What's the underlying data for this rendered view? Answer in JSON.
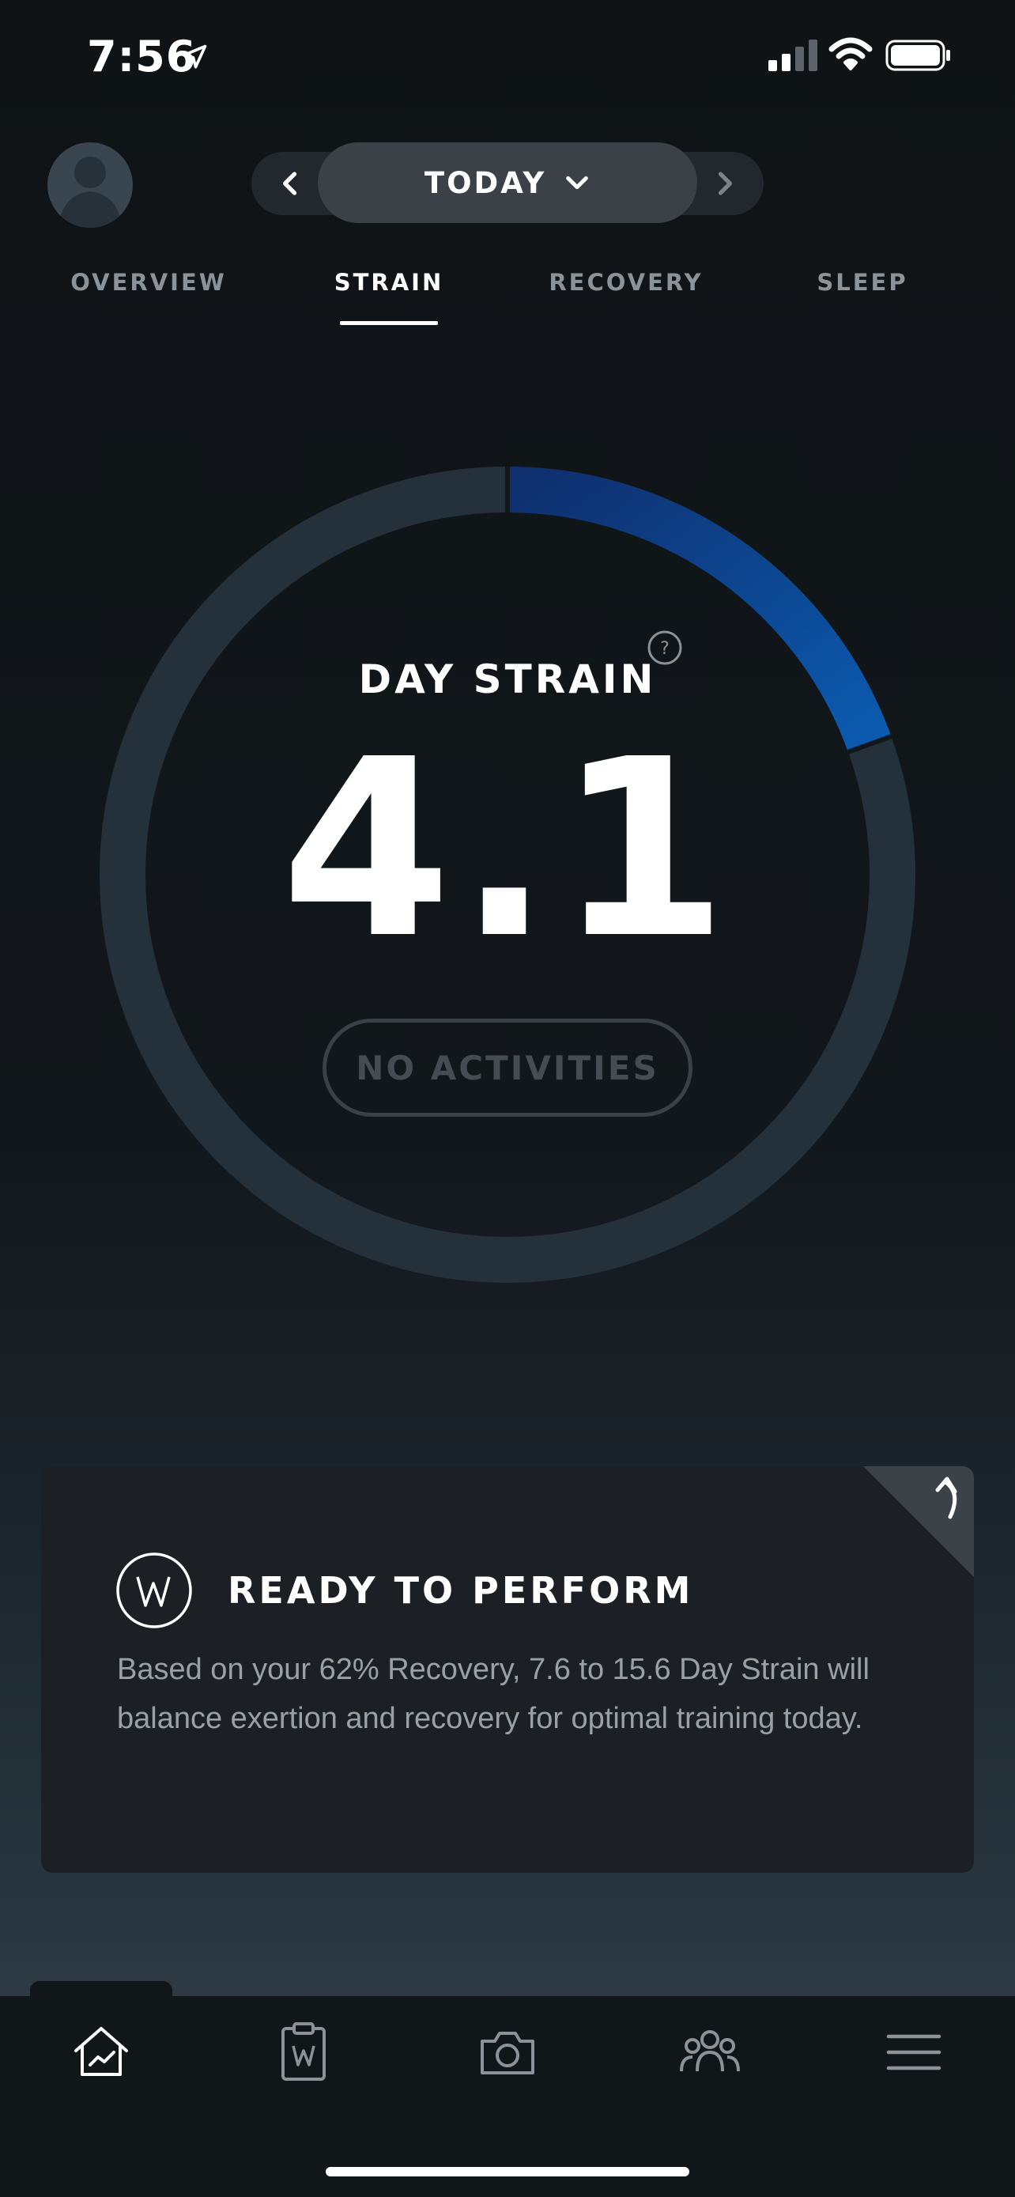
{
  "status_bar": {
    "time": "7:56"
  },
  "header": {
    "date_label": "TODAY"
  },
  "tabs": [
    {
      "label": "OVERVIEW",
      "active": false
    },
    {
      "label": "STRAIN",
      "active": true
    },
    {
      "label": "RECOVERY",
      "active": false
    },
    {
      "label": "SLEEP",
      "active": false
    }
  ],
  "strain": {
    "title": "DAY STRAIN",
    "value": "4.1",
    "activities_label": "NO ACTIVITIES",
    "help_symbol": "?",
    "max_scale": 21,
    "ring_fill_fraction": 0.195
  },
  "card": {
    "title": "READY TO PERFORM",
    "body": "Based on your 62% Recovery, 7.6 to 15.6 Day Strain will balance exertion and recovery for optimal training today."
  },
  "bottom_nav": [
    {
      "icon": "home-chart-icon",
      "active": true
    },
    {
      "icon": "clipboard-icon",
      "active": false
    },
    {
      "icon": "camera-icon",
      "active": false
    },
    {
      "icon": "team-icon",
      "active": false
    },
    {
      "icon": "menu-icon",
      "active": false
    }
  ],
  "colors": {
    "accent_blue": "#0d56a6",
    "ring_track": "#25313a",
    "card_bg": "#1c2025",
    "tab_inactive": "#8b9399"
  }
}
